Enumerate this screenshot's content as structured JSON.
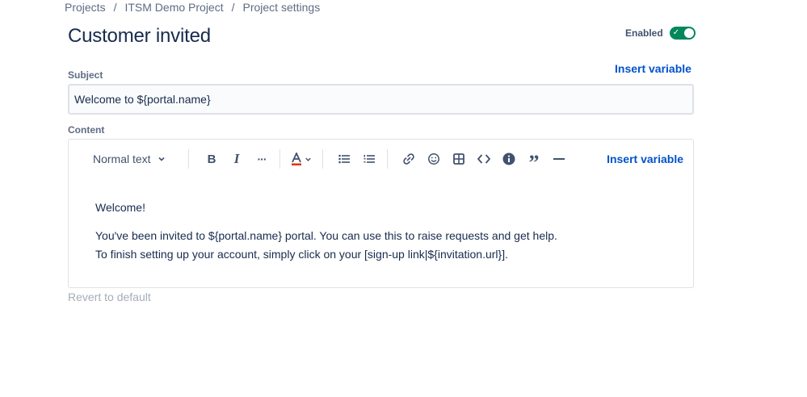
{
  "breadcrumb": {
    "items": [
      "Projects",
      "ITSM Demo Project",
      "Project settings"
    ],
    "separator": "/"
  },
  "header": {
    "title": "Customer invited",
    "enabled_label": "Enabled",
    "enabled": true
  },
  "subject": {
    "label": "Subject",
    "insert_variable": "Insert variable",
    "value": "Welcome to ${portal.name}"
  },
  "content": {
    "label": "Content",
    "toolbar": {
      "text_style": "Normal text",
      "insert_variable": "Insert variable",
      "icons": [
        "bold-icon",
        "italic-icon",
        "more-formatting-icon",
        "text-color-icon",
        "bullet-list-icon",
        "numbered-list-icon",
        "link-icon",
        "emoji-icon",
        "table-icon",
        "code-icon",
        "info-panel-icon",
        "quote-icon",
        "divider-icon"
      ]
    },
    "body": {
      "line1": "Welcome!",
      "line2": "You've been invited to ${portal.name} portal. You can use this to raise requests and get help.",
      "line3": "To finish setting up your account, simply click on your [sign-up link|${invitation.url}]."
    }
  },
  "footer": {
    "revert": "Revert to default"
  },
  "colors": {
    "accent": "#0052cc",
    "toggle_on": "#00875a",
    "text": "#172b4d",
    "muted": "#5e6c84",
    "disabled": "#a5adba"
  }
}
